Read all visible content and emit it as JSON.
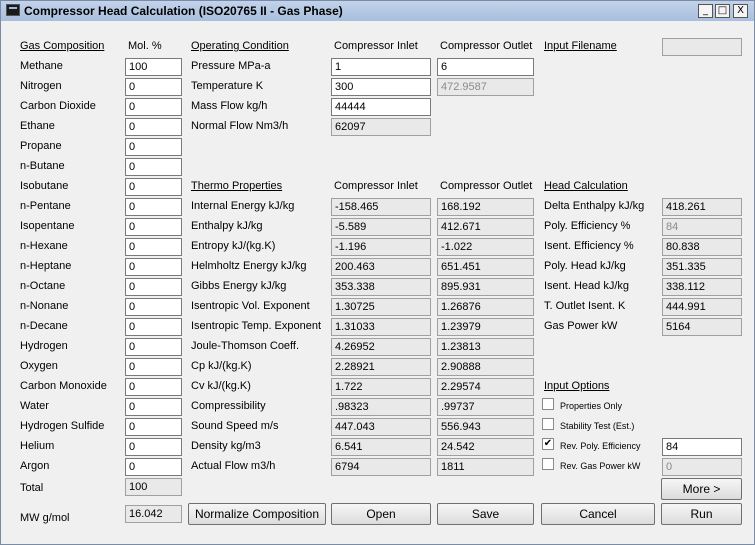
{
  "title": "Compressor Head Calculation (ISO20765 II - Gas Phase)",
  "window_buttons": {
    "minimize": "_",
    "maximize": "□",
    "close": "X"
  },
  "composition": {
    "header": "Gas Composition",
    "mol_header": "Mol. %",
    "items": [
      {
        "name": "Methane",
        "value": "100"
      },
      {
        "name": "Nitrogen",
        "value": "0"
      },
      {
        "name": "Carbon Dioxide",
        "value": "0"
      },
      {
        "name": "Ethane",
        "value": "0"
      },
      {
        "name": "Propane",
        "value": "0"
      },
      {
        "name": "n-Butane",
        "value": "0"
      },
      {
        "name": "Isobutane",
        "value": "0"
      },
      {
        "name": "n-Pentane",
        "value": "0"
      },
      {
        "name": "Isopentane",
        "value": "0"
      },
      {
        "name": "n-Hexane",
        "value": "0"
      },
      {
        "name": "n-Heptane",
        "value": "0"
      },
      {
        "name": "n-Octane",
        "value": "0"
      },
      {
        "name": "n-Nonane",
        "value": "0"
      },
      {
        "name": "n-Decane",
        "value": "0"
      },
      {
        "name": "Hydrogen",
        "value": "0"
      },
      {
        "name": "Oxygen",
        "value": "0"
      },
      {
        "name": "Carbon Monoxide",
        "value": "0"
      },
      {
        "name": "Water",
        "value": "0"
      },
      {
        "name": "Hydrogen Sulfide",
        "value": "0"
      },
      {
        "name": "Helium",
        "value": "0"
      },
      {
        "name": "Argon",
        "value": "0"
      }
    ],
    "total_label": "Total",
    "total_value": "100",
    "mw_label": "MW g/mol",
    "mw_value": "16.042"
  },
  "operating": {
    "header": "Operating Condition",
    "inlet_header": "Compressor Inlet",
    "outlet_header": "Compressor Outlet",
    "rows": [
      {
        "label": "Pressure MPa-a",
        "inlet": "1",
        "outlet": "6"
      },
      {
        "label": "Temperature K",
        "inlet": "300",
        "outlet": "472.9587"
      },
      {
        "label": "Mass Flow kg/h",
        "inlet": "44444",
        "outlet": ""
      },
      {
        "label": "Normal Flow Nm3/h",
        "inlet": "62097",
        "outlet": ""
      }
    ]
  },
  "input_filename": {
    "label": "Input Filename",
    "value": ""
  },
  "thermo": {
    "header": "Thermo Properties",
    "inlet_header": "Compressor Inlet",
    "outlet_header": "Compressor Outlet",
    "rows": [
      {
        "label": "Internal Energy kJ/kg",
        "inlet": "-158.465",
        "outlet": "168.192"
      },
      {
        "label": "Enthalpy kJ/kg",
        "inlet": "-5.589",
        "outlet": "412.671"
      },
      {
        "label": "Entropy kJ/(kg.K)",
        "inlet": "-1.196",
        "outlet": "-1.022"
      },
      {
        "label": "Helmholtz Energy kJ/kg",
        "inlet": "200.463",
        "outlet": "651.451"
      },
      {
        "label": "Gibbs Energy kJ/kg",
        "inlet": "353.338",
        "outlet": "895.931"
      },
      {
        "label": "Isentropic Vol. Exponent",
        "inlet": "1.30725",
        "outlet": "1.26876"
      },
      {
        "label": "Isentropic Temp. Exponent",
        "inlet": "1.31033",
        "outlet": "1.23979"
      },
      {
        "label": "Joule-Thomson Coeff.",
        "inlet": "4.26952",
        "outlet": "1.23813"
      },
      {
        "label": "Cp kJ/(kg.K)",
        "inlet": "2.28921",
        "outlet": "2.90888"
      },
      {
        "label": "Cv kJ/(kg.K)",
        "inlet": "1.722",
        "outlet": "2.29574"
      },
      {
        "label": "Compressibility",
        "inlet": ".98323",
        "outlet": ".99737"
      },
      {
        "label": "Sound Speed m/s",
        "inlet": "447.043",
        "outlet": "556.943"
      },
      {
        "label": "Density kg/m3",
        "inlet": "6.541",
        "outlet": "24.542"
      },
      {
        "label": "Actual Flow m3/h",
        "inlet": "6794",
        "outlet": "1811"
      }
    ]
  },
  "head": {
    "header": "Head Calculation",
    "rows": [
      {
        "label": "Delta Enthalpy kJ/kg",
        "value": "418.261"
      },
      {
        "label": "Poly. Efficiency %",
        "value": "84"
      },
      {
        "label": "Isent. Efficiency %",
        "value": "80.838"
      },
      {
        "label": "Poly. Head kJ/kg",
        "value": "351.335"
      },
      {
        "label": "Isent. Head kJ/kg",
        "value": "338.112"
      },
      {
        "label": "T. Outlet Isent. K",
        "value": "444.991"
      },
      {
        "label": "Gas Power kW",
        "value": "5164"
      }
    ]
  },
  "options": {
    "header": "Input Options",
    "items": [
      {
        "label": "Properties Only",
        "checked": false,
        "value": ""
      },
      {
        "label": "Stability Test (Est.)",
        "checked": false,
        "value": ""
      },
      {
        "label": "Rev. Poly. Efficiency",
        "checked": true,
        "value": "84"
      },
      {
        "label": "Rev. Gas Power kW",
        "checked": false,
        "value": "0"
      }
    ]
  },
  "buttons": {
    "more": "More >",
    "normalize": "Normalize Composition",
    "open": "Open",
    "save": "Save",
    "cancel": "Cancel",
    "run": "Run"
  }
}
